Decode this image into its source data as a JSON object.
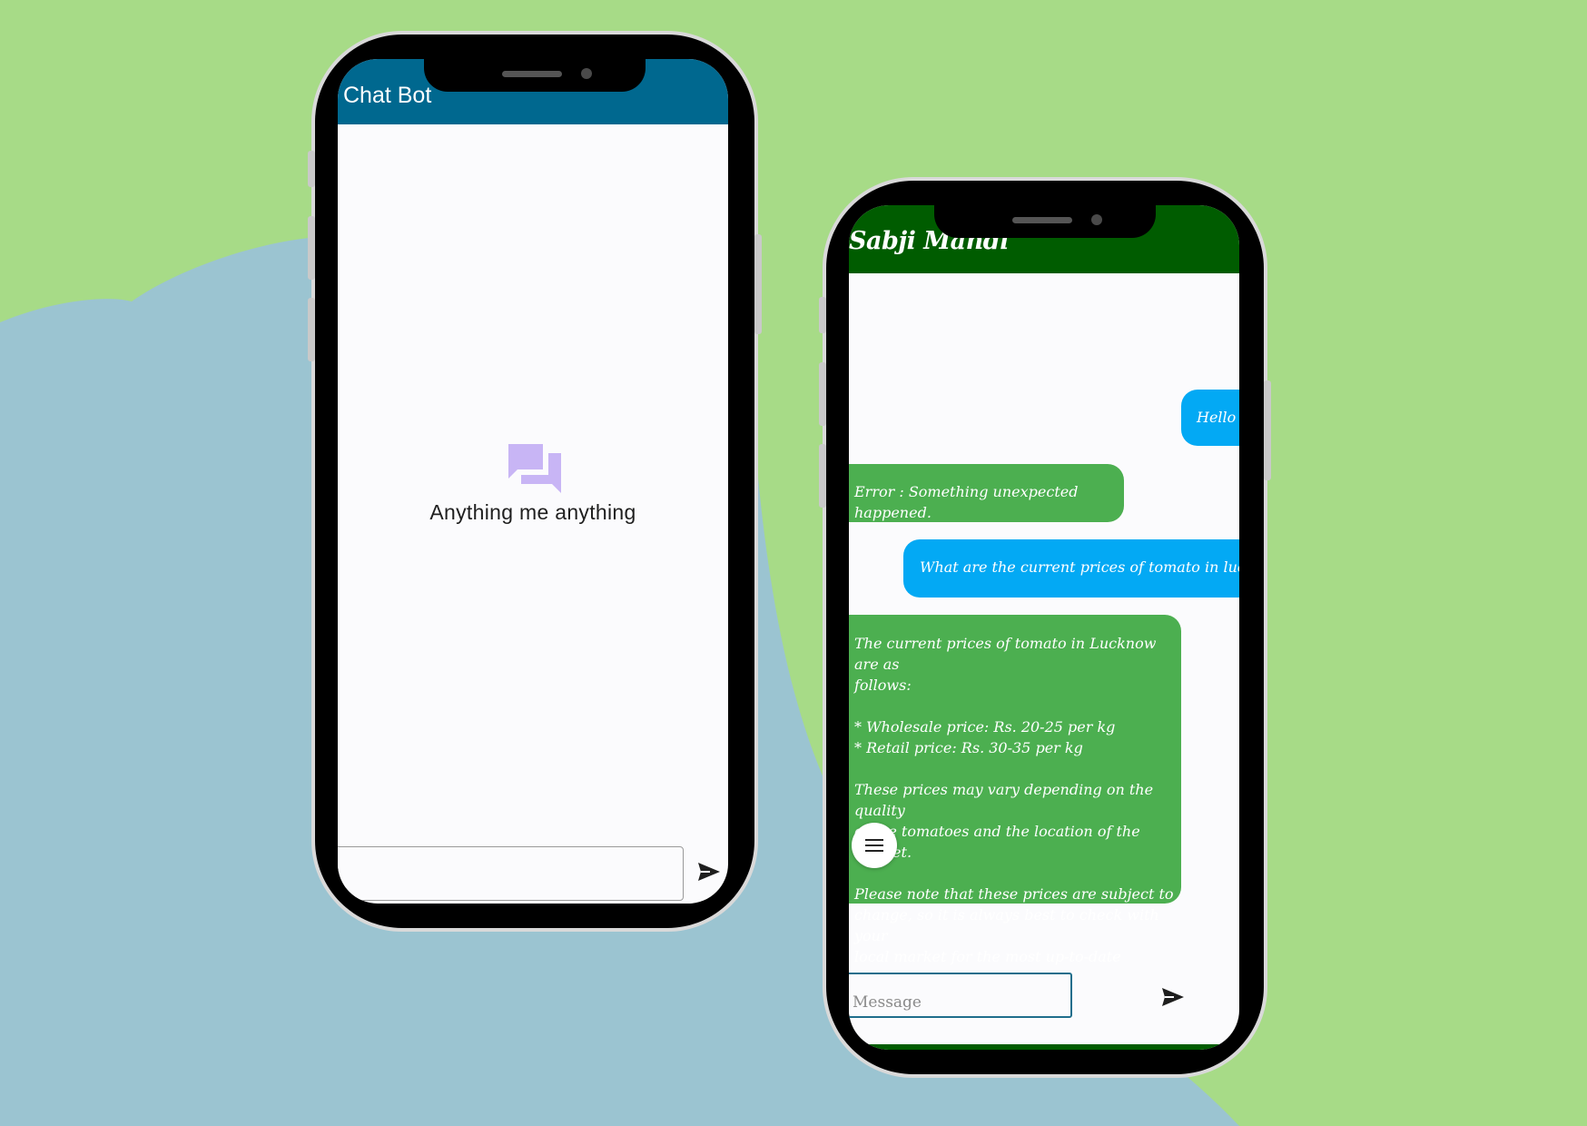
{
  "phone1": {
    "title": "Chat Bot",
    "empty_state_icon": "forum-icon",
    "empty_state_text": "Anything me anything",
    "send_icon": "send-icon",
    "input_value": "",
    "colors": {
      "app_bar": "#00688f",
      "icon": "#c8b5f5",
      "background": "#fbfbfd"
    }
  },
  "phone2": {
    "title": "Sabji Mandi",
    "messages": [
      {
        "role": "user",
        "text": "Hello"
      },
      {
        "role": "bot",
        "text": "Error : Something unexpected happened."
      },
      {
        "role": "user",
        "text": "What are the current prices of tomato in lucknow"
      },
      {
        "role": "bot",
        "text": "The current prices of tomato in Lucknow are as\nfollows:\n\n* Wholesale price: Rs. 20-25 per kg\n* Retail price: Rs. 30-35 per kg\n\nThese prices may vary depending on the quality\nof the tomatoes and the location of the market.\n\nPlease note that these prices are subject to\nchange, so it is always best to check with your\nlocal market for the most up-to-date information."
      }
    ],
    "menu_icon": "menu-icon",
    "input_placeholder": "Message",
    "send_icon": "send-icon",
    "colors": {
      "app_bar": "#005c00",
      "user_bubble": "#03a9f4",
      "bot_bubble": "#4caf50"
    }
  },
  "background_colors": {
    "green": "#a7db87",
    "blue": "#9bc4d1"
  }
}
